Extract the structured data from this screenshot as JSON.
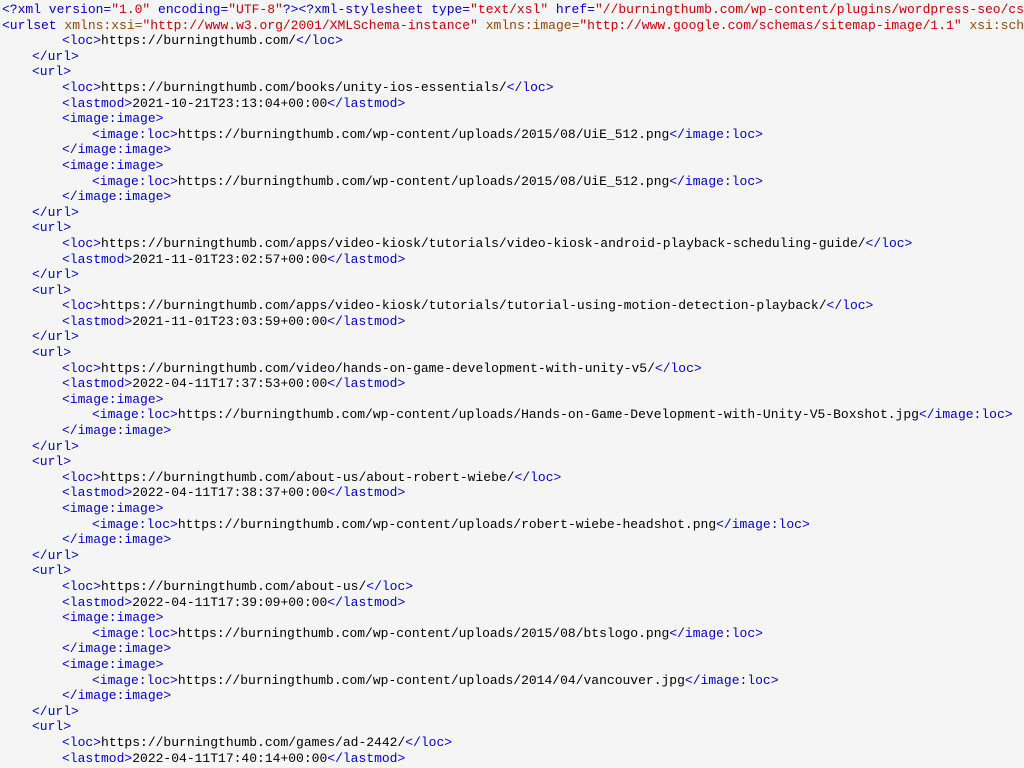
{
  "xml_declaration": "<?xml version=\"1.0\" encoding=\"UTF-8\"?>",
  "stylesheet": "<?xml-stylesheet type=\"text/xsl\" href=\"//burningthumb.com/wp-content/plugins/wordpress-seo/css/main-",
  "urlset_open": "<urlset",
  "attr_xmlns_xsi": "xmlns:xsi",
  "attr_xmlns_xsi_val": "\"http://www.w3.org/2001/XMLSchema-instance\"",
  "attr_xmlns_image": "xmlns:image",
  "attr_xmlns_image_val": "\"http://www.google.com/schemas/sitemap-image/1.1\"",
  "attr_schema": "xsi:schemaLoca",
  "entries": [
    {
      "loc": "https://burningthumb.com/",
      "lastmod": null,
      "images": []
    },
    {
      "loc": "https://burningthumb.com/books/unity-ios-essentials/",
      "lastmod": "2021-10-21T23:13:04+00:00",
      "images": [
        "https://burningthumb.com/wp-content/uploads/2015/08/UiE_512.png",
        "https://burningthumb.com/wp-content/uploads/2015/08/UiE_512.png"
      ]
    },
    {
      "loc": "https://burningthumb.com/apps/video-kiosk/tutorials/video-kiosk-android-playback-scheduling-guide/",
      "lastmod": "2021-11-01T23:02:57+00:00",
      "images": []
    },
    {
      "loc": "https://burningthumb.com/apps/video-kiosk/tutorials/tutorial-using-motion-detection-playback/",
      "lastmod": "2021-11-01T23:03:59+00:00",
      "images": []
    },
    {
      "loc": "https://burningthumb.com/video/hands-on-game-development-with-unity-v5/",
      "lastmod": "2022-04-11T17:37:53+00:00",
      "images": [
        "https://burningthumb.com/wp-content/uploads/Hands-on-Game-Development-with-Unity-V5-Boxshot.jpg"
      ]
    },
    {
      "loc": "https://burningthumb.com/about-us/about-robert-wiebe/",
      "lastmod": "2022-04-11T17:38:37+00:00",
      "images": [
        "https://burningthumb.com/wp-content/uploads/robert-wiebe-headshot.png"
      ]
    },
    {
      "loc": "https://burningthumb.com/about-us/",
      "lastmod": "2022-04-11T17:39:09+00:00",
      "images": [
        "https://burningthumb.com/wp-content/uploads/2015/08/btslogo.png",
        "https://burningthumb.com/wp-content/uploads/2014/04/vancouver.jpg"
      ]
    },
    {
      "loc": "https://burningthumb.com/games/ad-2442/",
      "lastmod": "2022-04-11T17:40:14+00:00",
      "images": [],
      "partial": true
    }
  ],
  "tags": {
    "url_open": "<url>",
    "url_close": "</url>",
    "loc_open": "<loc>",
    "loc_close": "</loc>",
    "lastmod_open": "<lastmod>",
    "lastmod_close": "</lastmod>",
    "image_open": "<image:image>",
    "image_close": "</image:image>",
    "imageloc_open": "<image:loc>",
    "imageloc_close": "</image:loc>"
  }
}
